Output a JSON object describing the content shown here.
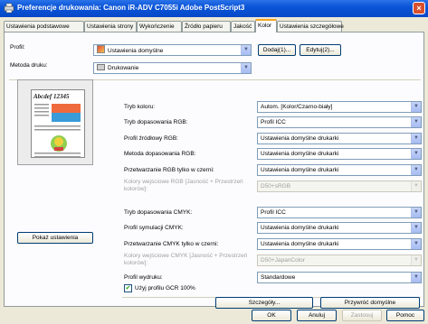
{
  "window": {
    "title": "Preferencje drukowania: Canon iR-ADV C7055i Adobe PostScript3",
    "close_label": "×"
  },
  "tabs": [
    {
      "label": "Ustawienia podstawowe"
    },
    {
      "label": "Ustawienia strony"
    },
    {
      "label": "Wykończenie"
    },
    {
      "label": "Źródło papieru"
    },
    {
      "label": "Jakość"
    },
    {
      "label": "Kolor"
    },
    {
      "label": "Ustawienia szczegółowe"
    }
  ],
  "profile": {
    "label": "Profil:",
    "value": "Ustawienia domyślne",
    "add_btn": "Dodaj(1)...",
    "edit_btn": "Edytuj(2)..."
  },
  "method": {
    "label": "Metoda druku:",
    "value": "Drukowanie"
  },
  "preview": {
    "sample_text": "Abcdef 12345",
    "show_btn": "Pokaż ustawienia"
  },
  "settings": [
    {
      "label": "Tryb koloru:",
      "value": "Autom. [Kolor/Czarno-biały]",
      "disabled": false
    },
    {
      "label": "Tryb dopasowania RGB:",
      "value": "Profil ICC",
      "disabled": false
    },
    {
      "label": "Profil źródłowy RGB:",
      "value": "Ustawienia domyślne drukarki",
      "disabled": false
    },
    {
      "label": "Metoda dopasowania RGB:",
      "value": "Ustawienia domyślne drukarki",
      "disabled": false
    },
    {
      "label": "Przetwarzanie RGB tylko w czerni:",
      "value": "Ustawienia domyślne drukarki",
      "disabled": false
    },
    {
      "label": "Kolory wejściowe RGB [Jasność + Przestrzeń kolorów]:",
      "value": "D50+sRGB",
      "disabled": true
    },
    {
      "label": "Tryb dopasowania CMYK:",
      "value": "Profil ICC",
      "disabled": false
    },
    {
      "label": "Profil symulacji CMYK:",
      "value": "Ustawienia domyślne drukarki",
      "disabled": false
    },
    {
      "label": "Przetwarzanie CMYK tylko w czerni:",
      "value": "Ustawienia domyślne drukarki",
      "disabled": false
    },
    {
      "label": "Kolory wejściowe CMYK [Jasność + Przestrzeń kolorów]:",
      "value": "D50+JapanColor",
      "disabled": true
    },
    {
      "label": "Profil wydruku:",
      "value": "Standardowe",
      "disabled": false
    }
  ],
  "gcr": {
    "label": "Użyj profilu GCR 100%",
    "checked": true
  },
  "details_btn": "Szczegóły...",
  "restore_btn": "Przywróć domyślne",
  "footer": {
    "ok": "OK",
    "cancel": "Anuluj",
    "apply": "Zastosuj",
    "help": "Pomoc"
  }
}
